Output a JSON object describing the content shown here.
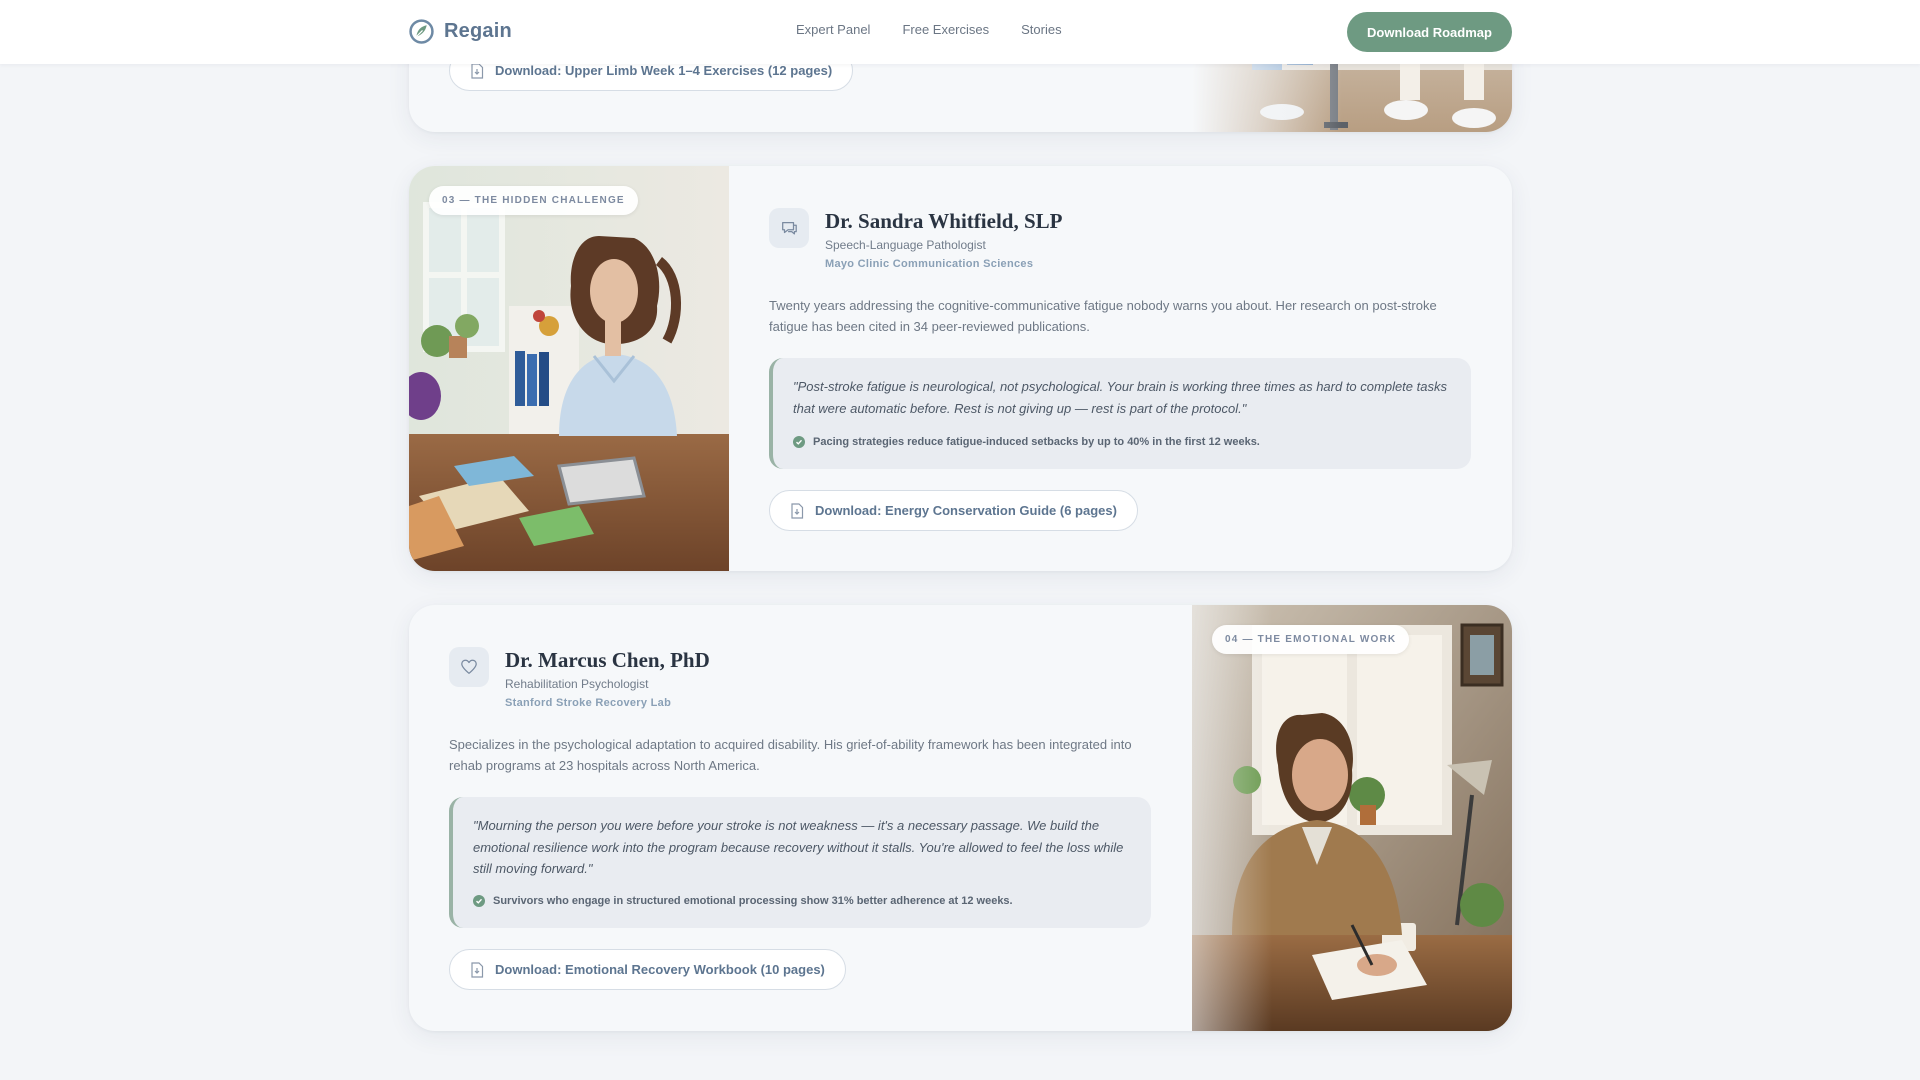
{
  "nav": {
    "brand": "Regain",
    "links": [
      "Expert Panel",
      "Free Exercises",
      "Stories"
    ],
    "cta": "Download Roadmap"
  },
  "top_card": {
    "download_label": "Download: Upper Limb Week 1–4 Exercises (12 pages)"
  },
  "experts": [
    {
      "badge": "03 — THE HIDDEN CHALLENGE",
      "icon": "message-icon",
      "name": "Dr. Sandra Whitfield, SLP",
      "role": "Speech-Language Pathologist",
      "institution": "Mayo Clinic Communication Sciences",
      "bio": "Twenty years addressing the cognitive-communicative fatigue nobody warns you about. Her research on post-stroke fatigue has been cited in 34 peer-reviewed publications.",
      "quote": "\"Post-stroke fatigue is neurological, not psychological. Your brain is working three times as hard to complete tasks that were automatic before. Rest is not giving up — rest is part of the protocol.\"",
      "stat": "Pacing strategies reduce fatigue-induced setbacks by up to 40% in the first 12 weeks.",
      "download_label": "Download: Energy Conservation Guide (6 pages)"
    },
    {
      "badge": "04 — THE EMOTIONAL WORK",
      "icon": "heart-icon",
      "name": "Dr. Marcus Chen, PhD",
      "role": "Rehabilitation Psychologist",
      "institution": "Stanford Stroke Recovery Lab",
      "bio": "Specializes in the psychological adaptation to acquired disability. His grief-of-ability framework has been integrated into rehab programs at 23 hospitals across North America.",
      "quote": "\"Mourning the person you were before your stroke is not weakness — it's a necessary passage. We build the emotional resilience work into the program because recovery without it stalls. You're allowed to feel the loss while still moving forward.\"",
      "stat": "Survivors who engage in structured emotional processing show 31% better adherence at 12 weeks.",
      "download_label": "Download: Emotional Recovery Workbook (10 pages)"
    }
  ],
  "colors": {
    "accent_green": "#6e9a82",
    "brand_blue": "#5d7590",
    "page_bg": "#f3f5f8"
  }
}
